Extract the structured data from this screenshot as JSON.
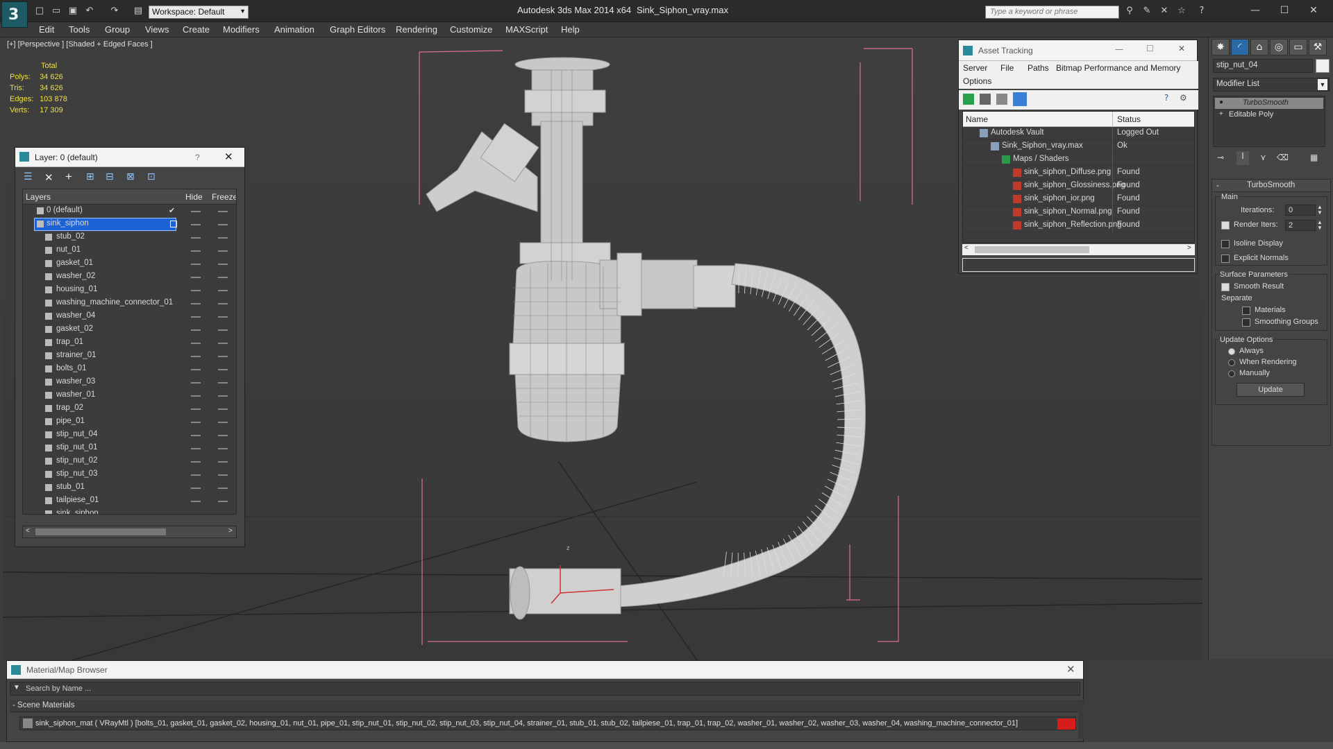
{
  "title": {
    "app": "Autodesk 3ds Max  2014 x64",
    "file": "Sink_Siphon_vray.max",
    "workspace": "Workspace: Default",
    "search_placeholder": "Type a keyword or phrase"
  },
  "menu": [
    "Edit",
    "Tools",
    "Group",
    "Views",
    "Create",
    "Modifiers",
    "Animation",
    "Graph Editors",
    "Rendering",
    "Customize",
    "MAXScript",
    "Help"
  ],
  "viewport": {
    "label": "[+] [Perspective ] [Shaded + Edged Faces ]",
    "stats": {
      "heading": "Total",
      "polys_label": "Polys:",
      "polys": "34 626",
      "tris_label": "Tris:",
      "tris": "34 626",
      "edges_label": "Edges:",
      "edges": "103 878",
      "verts_label": "Verts:",
      "verts": "17 309"
    },
    "axis_label": "z"
  },
  "layer_panel": {
    "title": "Layer: 0 (default)",
    "help": "?",
    "col_layers": "Layers",
    "col_hide": "Hide",
    "col_freeze": "Freeze",
    "rows": [
      {
        "name": "0 (default)",
        "level": 0,
        "checked": true
      },
      {
        "name": "sink_siphon",
        "level": 0,
        "selected": true
      },
      {
        "name": "stub_02",
        "level": 1
      },
      {
        "name": "nut_01",
        "level": 1
      },
      {
        "name": "gasket_01",
        "level": 1
      },
      {
        "name": "washer_02",
        "level": 1
      },
      {
        "name": "housing_01",
        "level": 1
      },
      {
        "name": "washing_machine_connector_01",
        "level": 1
      },
      {
        "name": "washer_04",
        "level": 1
      },
      {
        "name": "gasket_02",
        "level": 1
      },
      {
        "name": "trap_01",
        "level": 1
      },
      {
        "name": "strainer_01",
        "level": 1
      },
      {
        "name": "bolts_01",
        "level": 1
      },
      {
        "name": "washer_03",
        "level": 1
      },
      {
        "name": "washer_01",
        "level": 1
      },
      {
        "name": "trap_02",
        "level": 1
      },
      {
        "name": "pipe_01",
        "level": 1
      },
      {
        "name": "stip_nut_04",
        "level": 1
      },
      {
        "name": "stip_nut_01",
        "level": 1
      },
      {
        "name": "stip_nut_02",
        "level": 1
      },
      {
        "name": "stip_nut_03",
        "level": 1
      },
      {
        "name": "stub_01",
        "level": 1
      },
      {
        "name": "tailpiese_01",
        "level": 1
      },
      {
        "name": "sink_siphon",
        "level": 1
      }
    ]
  },
  "asset_tracking": {
    "title": "Asset Tracking",
    "menu": [
      "Server",
      "File",
      "Paths",
      "Bitmap Performance and Memory"
    ],
    "menu2": "Options",
    "col_name": "Name",
    "col_status": "Status",
    "rows": [
      {
        "name": "Autodesk Vault",
        "status": "Logged Out",
        "indent": 1
      },
      {
        "name": "Sink_Siphon_vray.max",
        "status": "Ok",
        "indent": 2
      },
      {
        "name": "Maps / Shaders",
        "status": "",
        "indent": 3
      },
      {
        "name": "sink_siphon_Diffuse.png",
        "status": "Found",
        "indent": 4
      },
      {
        "name": "sink_siphon_Glossiness.png",
        "status": "Found",
        "indent": 4
      },
      {
        "name": "sink_siphon_ior.png",
        "status": "Found",
        "indent": 4
      },
      {
        "name": "sink_siphon_Normal.png",
        "status": "Found",
        "indent": 4
      },
      {
        "name": "sink_siphon_Reflection.png",
        "status": "Found",
        "indent": 4
      }
    ]
  },
  "command_panel": {
    "object_name": "stip_nut_04",
    "modifier_list": "Modifier List",
    "stack": [
      "TurboSmooth",
      "Editable Poly"
    ],
    "rollout_title": "TurboSmooth",
    "main_label": "Main",
    "iterations_label": "Iterations:",
    "iterations": "0",
    "render_iters_label": "Render Iters:",
    "render_iters": "2",
    "isoline_label": "Isoline Display",
    "explicit_normals_label": "Explicit Normals",
    "surface_params_label": "Surface Parameters",
    "smooth_result_label": "Smooth Result",
    "separate_label": "Separate",
    "materials_label": "Materials",
    "smoothing_groups_label": "Smoothing Groups",
    "update_options_label": "Update Options",
    "always_label": "Always",
    "when_rendering_label": "When Rendering",
    "manually_label": "Manually",
    "update_button": "Update"
  },
  "material_browser": {
    "title": "Material/Map Browser",
    "search_placeholder": "Search by Name ...",
    "section": "- Scene Materials",
    "material_entry": "sink_siphon_mat  ( VRayMtl )  [bolts_01, gasket_01, gasket_02, housing_01, nut_01, pipe_01, stip_nut_01, stip_nut_02, stip_nut_03, stip_nut_04, strainer_01, stub_01, stub_02, tailpiese_01, trap_01, trap_02, washer_01, washer_02, washer_03, washer_04, washing_machine_connector_01]"
  },
  "colors": {
    "accent_selected": "#1e63d6",
    "stats_yellow": "#f0e040",
    "bbox_pink": "#e0708a",
    "material_swatch": "#d81c1c"
  }
}
